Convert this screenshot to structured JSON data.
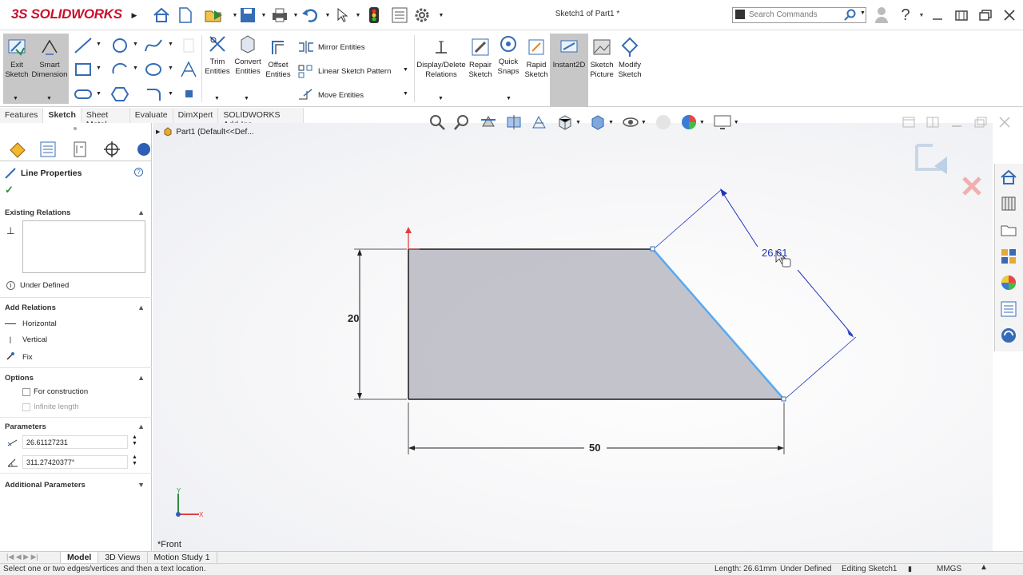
{
  "app": {
    "brand": "SOLIDWORKS",
    "doc_title": "Sketch1 of Part1 *"
  },
  "search": {
    "placeholder": "Search Commands"
  },
  "ribbon": {
    "exit_sketch": "Exit Sketch",
    "smart_dimension": "Smart Dimension",
    "trim_entities": "Trim Entities",
    "convert_entities": "Convert Entities",
    "offset_entities": "Offset Entities",
    "mirror_entities": "Mirror Entities",
    "linear_sketch_pattern": "Linear Sketch Pattern",
    "move_entities": "Move Entities",
    "display_delete_relations": "Display/Delete Relations",
    "repair_sketch": "Repair Sketch",
    "quick_snaps": "Quick Snaps",
    "rapid_sketch": "Rapid Sketch",
    "instant2d": "Instant2D",
    "sketch_picture": "Sketch Picture",
    "modify_sketch": "Modify Sketch"
  },
  "tabs": [
    "Features",
    "Sketch",
    "Sheet Metal",
    "Evaluate",
    "DimXpert",
    "SOLIDWORKS Add-Ins"
  ],
  "tree": {
    "part_label": "Part1  (Default<<Def..."
  },
  "panel": {
    "title": "Line Properties",
    "existing_relations": "Existing Relations",
    "under_defined": "Under Defined",
    "add_relations": "Add Relations",
    "horizontal": "Horizontal",
    "vertical": "Vertical",
    "fix": "Fix",
    "options": "Options",
    "for_construction": "For construction",
    "infinite_length": "Infinite length",
    "parameters": "Parameters",
    "length_value": "26.61127231",
    "angle_value": "311.27420377°",
    "additional_parameters": "Additional Parameters"
  },
  "sketch": {
    "dim_height": "20",
    "dim_width": "50",
    "dim_slant": "26.61",
    "view_label": "*Front",
    "triad_x": "X",
    "triad_y": "Y"
  },
  "bottom_tabs": [
    "Model",
    "3D Views",
    "Motion Study 1"
  ],
  "status": {
    "hint": "Select one or two edges/vertices and then a text location.",
    "length": "Length: 26.61mm",
    "state": "Under Defined",
    "editing": "Editing Sketch1",
    "units": "MMGS"
  },
  "colors": {
    "brand_red": "#c8102e",
    "dim_blue": "#2233bb",
    "selected_line": "#5aa9f0",
    "sketch_fill": "#b9b9c2"
  }
}
